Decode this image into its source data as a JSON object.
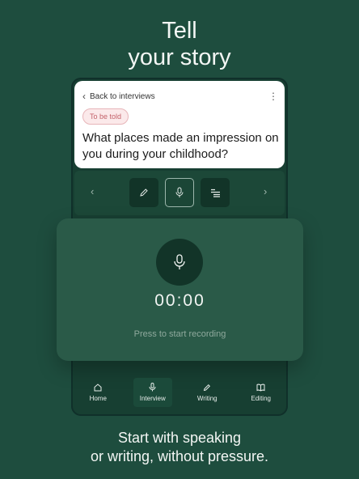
{
  "headline": {
    "line1": "Tell",
    "line2": "your story"
  },
  "card": {
    "back_label": "Back to interviews",
    "badge": "To be told",
    "question": "What places made an impression on you during your childhood?"
  },
  "toolbar": {
    "tools": [
      {
        "icon": "pencil-icon",
        "active": false
      },
      {
        "icon": "microphone-icon",
        "active": true
      },
      {
        "icon": "text-lines-icon",
        "active": false
      }
    ]
  },
  "recorder": {
    "timer": "00:00",
    "hint": "Press to start recording"
  },
  "tabs": [
    {
      "label": "Home",
      "icon": "home-icon",
      "active": false
    },
    {
      "label": "Interview",
      "icon": "microphone-icon",
      "active": true
    },
    {
      "label": "Writing",
      "icon": "pencil-icon",
      "active": false
    },
    {
      "label": "Editing",
      "icon": "book-icon",
      "active": false
    }
  ],
  "footer": {
    "line1": "Start with speaking",
    "line2": "or writing, without pressure."
  },
  "colors": {
    "background": "#1e4d3e",
    "badge_text": "#c4636b",
    "card": "#ffffff"
  }
}
